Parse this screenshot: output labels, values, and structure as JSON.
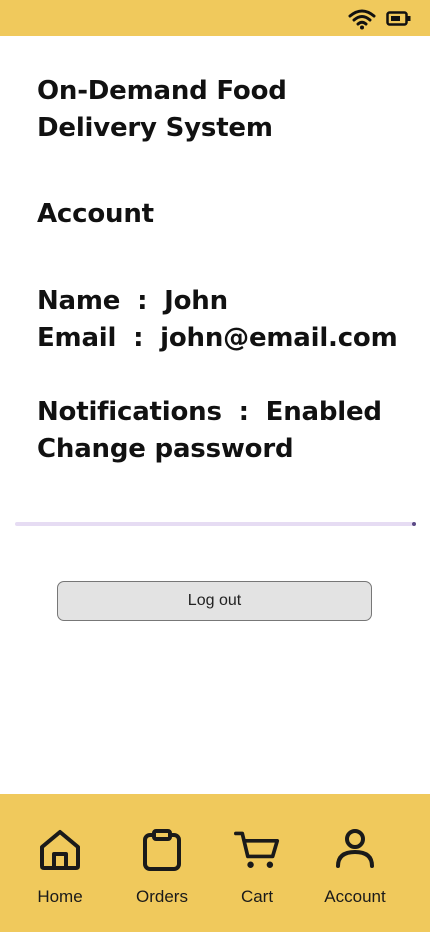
{
  "theme": {
    "accent": "#F0C95C",
    "divider_color": "#E6DCF3"
  },
  "status_bar": {
    "icons": [
      "wifi-icon",
      "battery-icon"
    ]
  },
  "header": {
    "title_line1": "On-Demand Food",
    "title_line2": "Delivery System"
  },
  "section": {
    "heading": "Account"
  },
  "profile": {
    "name_label": "Name",
    "name_value": "John",
    "email_label": "Email",
    "email_value": "john@email.com",
    "separator": ":"
  },
  "settings": {
    "notifications_label": "Notifications",
    "notifications_value": "Enabled",
    "change_password_label": "Change password"
  },
  "actions": {
    "logout_label": "Log out"
  },
  "bottom_nav": {
    "items": [
      {
        "label": "Home",
        "icon": "home-icon"
      },
      {
        "label": "Orders",
        "icon": "clipboard-icon"
      },
      {
        "label": "Cart",
        "icon": "cart-icon"
      },
      {
        "label": "Account",
        "icon": "user-icon"
      }
    ]
  }
}
